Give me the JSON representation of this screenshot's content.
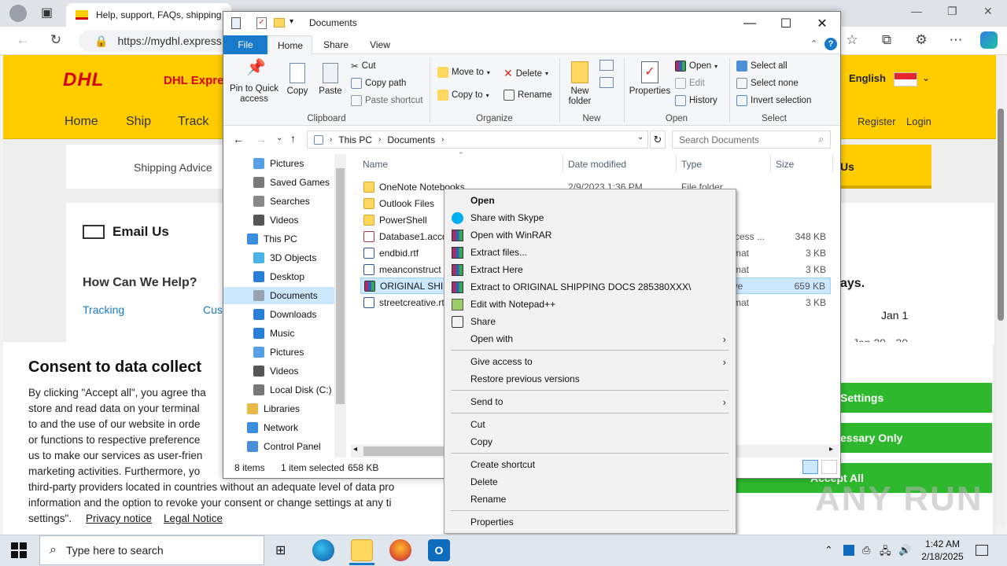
{
  "browser": {
    "tab_title": "Help, support, FAQs, shipping a",
    "url": "https://mydhl.express.",
    "window_controls": {
      "minimize": "—",
      "restore": "❐",
      "close": "✕"
    }
  },
  "dhl": {
    "logo": "DHL",
    "brand": "DHL Expre",
    "language": "English",
    "nav": [
      "Home",
      "Ship",
      "Track"
    ],
    "nav_right": [
      "Register",
      "Login"
    ],
    "shipping_advice": "Shipping Advice",
    "us_tab": "Us",
    "email_us": "Email Us",
    "how_help": "How Can We Help?",
    "tracking": "Tracking",
    "cus": "Cus",
    "ays": "ays.",
    "jan1": "Jan 1",
    "jan_range": "Jan 29 - 30"
  },
  "consent": {
    "title": "Consent to data collect",
    "lines": [
      "By clicking \"Accept all\", you agree tha",
      "store and read data on your terminal",
      "to and the use of our website in orde",
      "or functions to respective preference",
      "us to make our services as user-frien",
      "marketing activities.  Furthermore, yo",
      "third-party providers located in countries without an adequate level of data pro",
      "information and the option to revoke your consent or change settings at any ti",
      "settings\"."
    ],
    "privacy": "Privacy notice",
    "legal": "Legal Notice",
    "btn_settings": "Settings",
    "btn_necessary": "essary Only",
    "btn_accept": "Accept All"
  },
  "explorer": {
    "title": "Documents",
    "tabs": [
      "File",
      "Home",
      "Share",
      "View"
    ],
    "ribbon": {
      "pin": "Pin to Quick access",
      "copy": "Copy",
      "paste": "Paste",
      "cut": "Cut",
      "copy_path": "Copy path",
      "paste_shortcut": "Paste shortcut",
      "move_to": "Move to",
      "copy_to": "Copy to",
      "delete": "Delete",
      "rename": "Rename",
      "new_folder": "New folder",
      "properties": "Properties",
      "open": "Open",
      "edit": "Edit",
      "history": "History",
      "select_all": "Select all",
      "select_none": "Select none",
      "invert_selection": "Invert selection",
      "groups": [
        "Clipboard",
        "Organize",
        "New",
        "Open",
        "Select"
      ]
    },
    "breadcrumb": [
      "This PC",
      "Documents"
    ],
    "search_placeholder": "Search Documents",
    "nav": [
      {
        "label": "Pictures",
        "indent": 2
      },
      {
        "label": "Saved Games",
        "indent": 2
      },
      {
        "label": "Searches",
        "indent": 2
      },
      {
        "label": "Videos",
        "indent": 2
      },
      {
        "label": "This PC",
        "indent": 1
      },
      {
        "label": "3D Objects",
        "indent": 2
      },
      {
        "label": "Desktop",
        "indent": 2
      },
      {
        "label": "Documents",
        "indent": 2
      },
      {
        "label": "Downloads",
        "indent": 2
      },
      {
        "label": "Music",
        "indent": 2
      },
      {
        "label": "Pictures",
        "indent": 2
      },
      {
        "label": "Videos",
        "indent": 2
      },
      {
        "label": "Local Disk (C:)",
        "indent": 2
      },
      {
        "label": "Libraries",
        "indent": 1
      },
      {
        "label": "Network",
        "indent": 1
      },
      {
        "label": "Control Panel",
        "indent": 1
      }
    ],
    "columns": [
      "Name",
      "Date modified",
      "Type",
      "Size"
    ],
    "files": [
      {
        "name": "OneNote Notebooks",
        "date": "2/9/2023 1:36 PM",
        "type": "File folder",
        "size": "",
        "ext": "",
        "icon": "folder"
      },
      {
        "name": "Outlook Files",
        "date": "",
        "type": "",
        "size": "",
        "ext": "",
        "icon": "folder"
      },
      {
        "name": "PowerShell",
        "date": "",
        "type": "",
        "size": "",
        "ext": "",
        "icon": "folder"
      },
      {
        "name": "Database1.accd",
        "date": "",
        "type": "",
        "size": "348 KB",
        "ext": "ccess ...",
        "icon": "access"
      },
      {
        "name": "endbid.rtf",
        "date": "",
        "type": "",
        "size": "3 KB",
        "ext": "rmat",
        "icon": "word"
      },
      {
        "name": "meanconstruct",
        "date": "",
        "type": "",
        "size": "3 KB",
        "ext": "rmat",
        "icon": "word"
      },
      {
        "name": "ORIGINAL SHIP",
        "date": "",
        "type": "",
        "size": "659 KB",
        "ext": "ive",
        "icon": "rar"
      },
      {
        "name": "streetcreative.rt",
        "date": "",
        "type": "",
        "size": "3 KB",
        "ext": "rmat",
        "icon": "word"
      }
    ],
    "status": {
      "items": "8 items",
      "selected": "1 item selected",
      "size": "658 KB"
    }
  },
  "context_menu": [
    {
      "label": "Open",
      "bold": true,
      "icon": "",
      "sub": false
    },
    {
      "label": "Share with Skype",
      "icon": "skype",
      "sub": false
    },
    {
      "label": "Open with WinRAR",
      "icon": "rar",
      "sub": false
    },
    {
      "label": "Extract files...",
      "icon": "rar",
      "sub": false
    },
    {
      "label": "Extract Here",
      "icon": "rar",
      "sub": false
    },
    {
      "label": "Extract to ORIGINAL SHIPPING DOCS 285380XXX\\",
      "icon": "rar",
      "sub": false
    },
    {
      "label": "Edit with Notepad++",
      "icon": "notepad",
      "sub": false
    },
    {
      "label": "Share",
      "icon": "share",
      "sub": false
    },
    {
      "label": "Open with",
      "icon": "",
      "sub": true
    },
    {
      "sep": true
    },
    {
      "label": "Give access to",
      "icon": "",
      "sub": true
    },
    {
      "label": "Restore previous versions",
      "icon": "",
      "sub": false
    },
    {
      "sep": true
    },
    {
      "label": "Send to",
      "icon": "",
      "sub": true
    },
    {
      "sep": true
    },
    {
      "label": "Cut",
      "icon": "",
      "sub": false
    },
    {
      "label": "Copy",
      "icon": "",
      "sub": false
    },
    {
      "sep": true
    },
    {
      "label": "Create shortcut",
      "icon": "",
      "sub": false
    },
    {
      "label": "Delete",
      "icon": "",
      "sub": false
    },
    {
      "label": "Rename",
      "icon": "",
      "sub": false
    },
    {
      "sep": true
    },
    {
      "label": "Properties",
      "icon": "",
      "sub": false
    }
  ],
  "taskbar": {
    "search_placeholder": "Type here to search",
    "time": "1:42 AM",
    "date": "2/18/2025"
  },
  "watermark": "ANY RUN",
  "colors": {
    "dhl_yellow": "#ffcc00",
    "dhl_red": "#d40511",
    "accent": "#1979ca",
    "green": "#2db82d",
    "selection": "#cce8ff"
  }
}
